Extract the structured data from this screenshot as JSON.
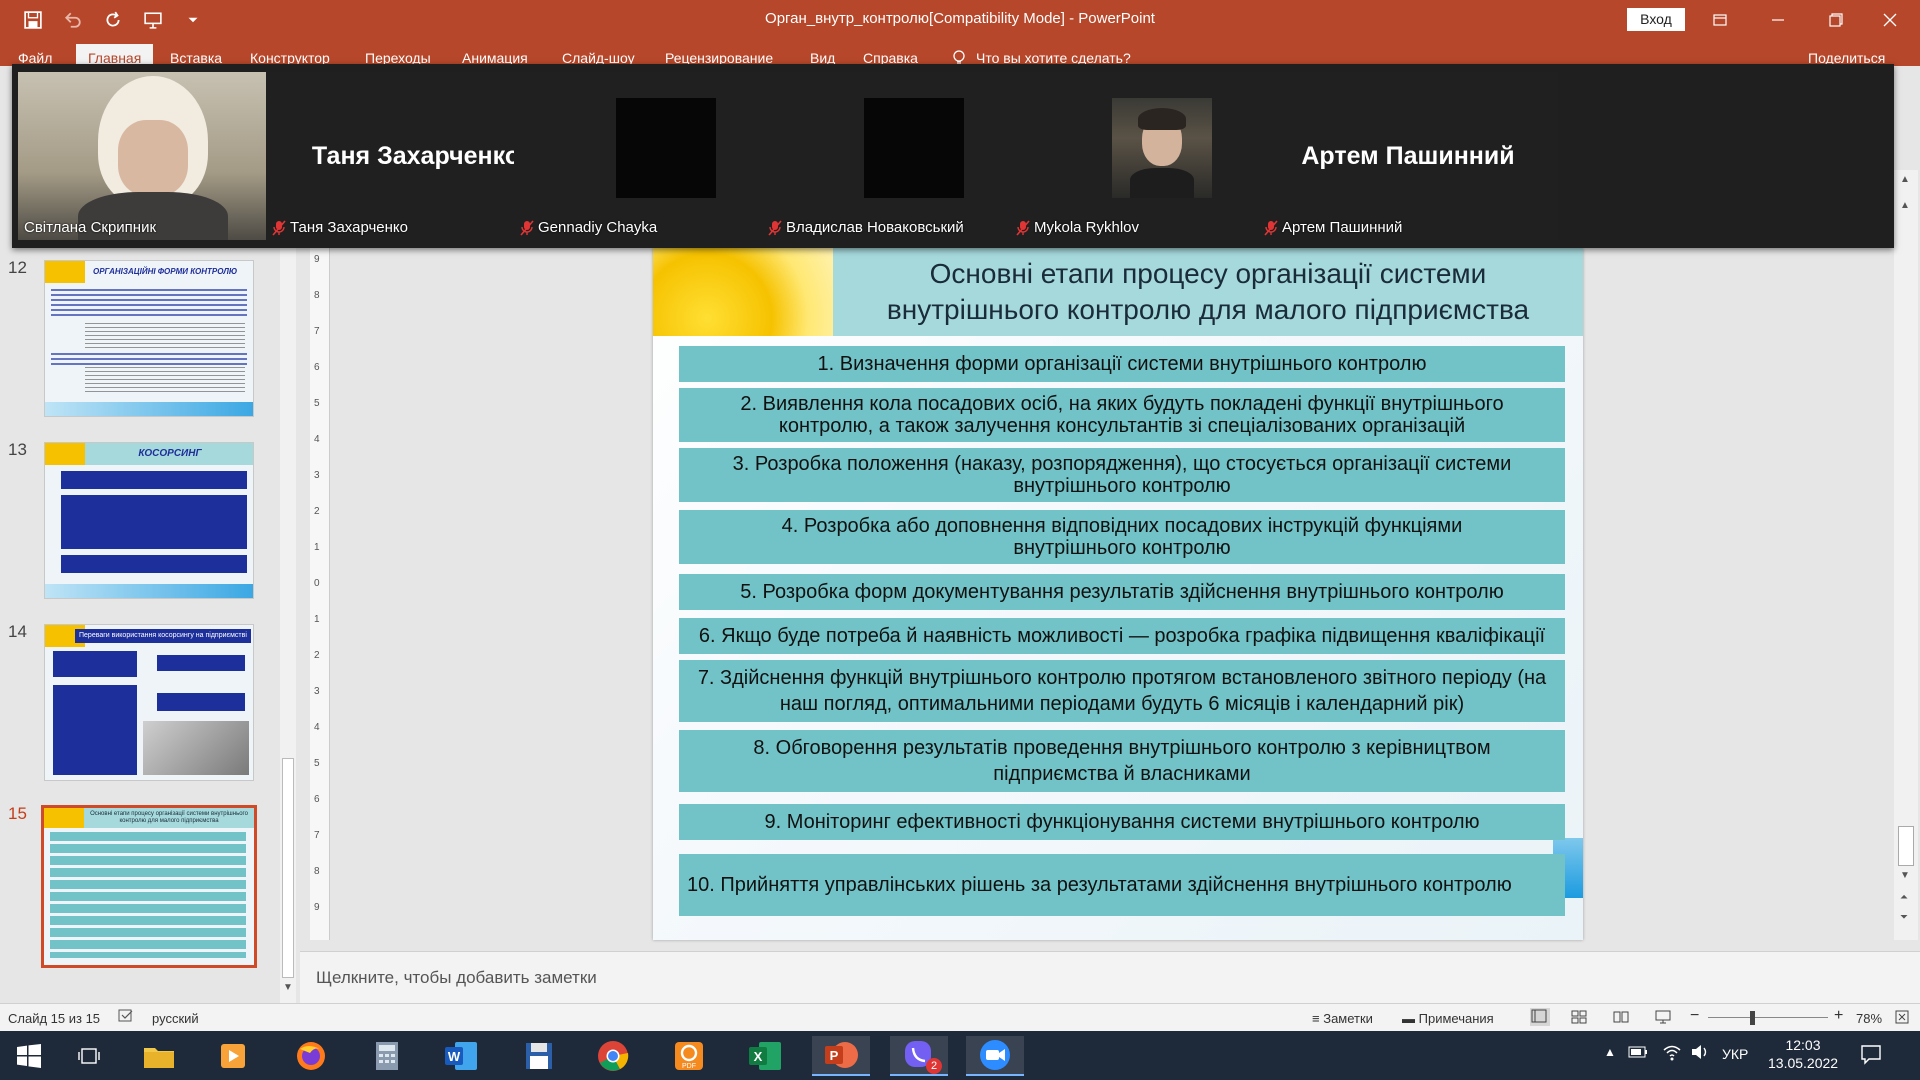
{
  "titlebar": {
    "doc_title": "Орган_внутр_контролю[Compatibility Mode]  -  PowerPoint",
    "signin": "Вход"
  },
  "ribbon": {
    "tabs": [
      "Файл",
      "Главная",
      "Вставка",
      "Конструктор",
      "Переходы",
      "Анимация",
      "Слайд-шоу",
      "Рецензирование",
      "Вид",
      "Справка"
    ],
    "active_tab": "Главная",
    "tell_me": "Что вы хотите сделать?",
    "share": "Поделиться"
  },
  "video": {
    "participants": [
      {
        "name": "Світлана Скрипник",
        "muted": false,
        "display": "video"
      },
      {
        "name": "Таня Захарченко",
        "muted": true,
        "display": "name"
      },
      {
        "name": "Gennadiy Chayka",
        "muted": true,
        "display": "black"
      },
      {
        "name": "Владислав Новаковський",
        "muted": true,
        "display": "black"
      },
      {
        "name": "Mykola Rykhlov",
        "muted": true,
        "display": "photo"
      },
      {
        "name": "Артем Пашинний",
        "muted": true,
        "display": "name"
      }
    ]
  },
  "slides_panel": {
    "thumbnails": [
      {
        "num": "12",
        "title": "ОРГАНІЗАЦІЙНІ ФОРМИ КОНТРОЛЮ"
      },
      {
        "num": "13",
        "title": "КОСОРСИНГ"
      },
      {
        "num": "14",
        "title": "Переваги використання косорсингу на підприємстві"
      },
      {
        "num": "15",
        "title": "Основні етапи процесу організації системи внутрішнього контролю для малого підприємства"
      }
    ],
    "active": "15"
  },
  "slide": {
    "title_line1": "Основні етапи процесу організації системи",
    "title_line2": "внутрішнього контролю для малого підприємства",
    "steps": [
      "1. Визначення форми організації системи внутрішнього контролю",
      "2. Виявлення кола посадових осіб, на яких будуть покладені функції внутрішнього контролю, а також залучення консультантів зі спеціалізованих організацій",
      "3. Розробка положення (наказу, розпорядження), що стосується організації системи внутрішнього контролю",
      "4. Розробка або доповнення відповідних посадових інструкцій функціями внутрішнього контролю",
      "5. Розробка форм документування результатів здійснення внутрішнього контролю",
      "6. Якщо буде потреба й наявність можливості — розробка графіка підвищення кваліфікації",
      "7. Здійснення функцій внутрішнього контролю протягом встановленого звітного періоду (на наш погляд, оптимальними періодами будуть 6 місяців і календарний рік)",
      "8. Обговорення результатів проведення внутрішнього контролю з керівництвом підприємства й власниками",
      "9. Моніторинг ефективності функціонування системи внутрішнього контролю",
      "10. Прийняття управлінських рішень за результатами здійснення внутрішнього контролю"
    ]
  },
  "ruler": {
    "ticks": [
      "9",
      "8",
      "7",
      "6",
      "5",
      "4",
      "3",
      "2",
      "1",
      "0",
      "1",
      "2",
      "3",
      "4",
      "5",
      "6",
      "7",
      "8",
      "9"
    ]
  },
  "notes": {
    "placeholder": "Щелкните, чтобы добавить заметки"
  },
  "statusbar": {
    "slide_info": "Слайд 15 из 15",
    "language": "русский",
    "notes_btn": "Заметки",
    "comments_btn": "Примечания",
    "zoom": "78%"
  },
  "taskbar": {
    "lang": "УКР",
    "time": "12:03",
    "date": "13.05.2022",
    "viber_badge": "2"
  },
  "colors": {
    "accent": "#b7472a",
    "step_bg": "#72c3c7",
    "title_bg": "#a6d9dc"
  }
}
